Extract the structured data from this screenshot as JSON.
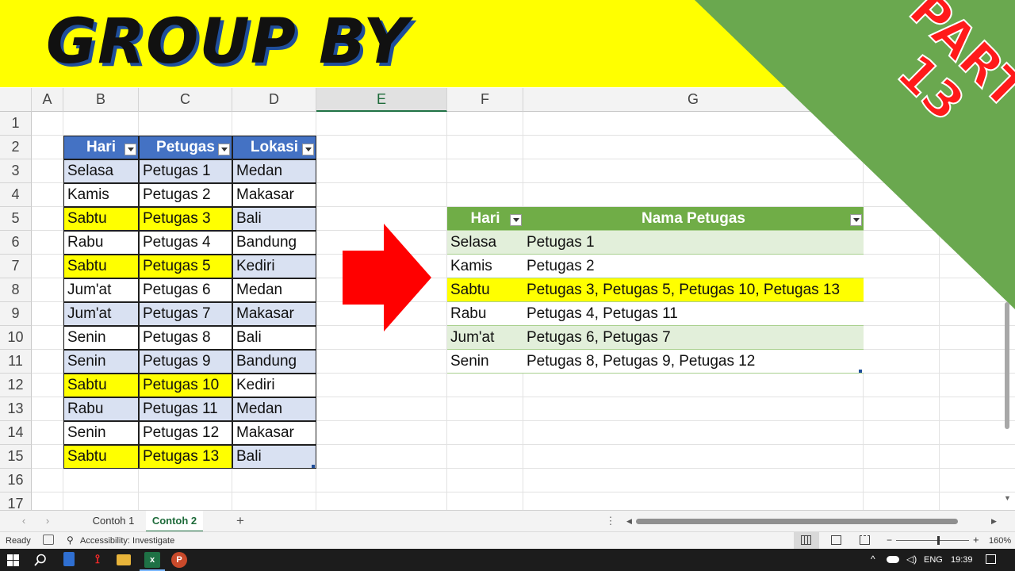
{
  "banner": {
    "title": "GROUP BY",
    "part_line1": "PART",
    "part_line2": "13"
  },
  "sheet": {
    "columns": [
      "A",
      "B",
      "C",
      "D",
      "E",
      "F",
      "G"
    ],
    "rows": [
      "1",
      "2",
      "3",
      "4",
      "5",
      "6",
      "7",
      "8",
      "9",
      "10",
      "11",
      "12",
      "13",
      "14",
      "15",
      "16",
      "17"
    ],
    "selected_column": "E"
  },
  "table1": {
    "headers": [
      "Hari",
      "Petugas",
      "Lokasi"
    ],
    "rows": [
      {
        "hari": "Selasa",
        "petugas": "Petugas 1",
        "lokasi": "Medan",
        "highlight": false
      },
      {
        "hari": "Kamis",
        "petugas": "Petugas 2",
        "lokasi": "Makasar",
        "highlight": false
      },
      {
        "hari": "Sabtu",
        "petugas": "Petugas 3",
        "lokasi": "Bali",
        "highlight": true
      },
      {
        "hari": "Rabu",
        "petugas": "Petugas 4",
        "lokasi": "Bandung",
        "highlight": false
      },
      {
        "hari": "Sabtu",
        "petugas": "Petugas 5",
        "lokasi": "Kediri",
        "highlight": true
      },
      {
        "hari": "Jum'at",
        "petugas": "Petugas 6",
        "lokasi": "Medan",
        "highlight": false
      },
      {
        "hari": "Jum'at",
        "petugas": "Petugas 7",
        "lokasi": "Makasar",
        "highlight": false
      },
      {
        "hari": "Senin",
        "petugas": "Petugas 8",
        "lokasi": "Bali",
        "highlight": false
      },
      {
        "hari": "Senin",
        "petugas": "Petugas 9",
        "lokasi": "Bandung",
        "highlight": false
      },
      {
        "hari": "Sabtu",
        "petugas": "Petugas 10",
        "lokasi": "Kediri",
        "highlight": true
      },
      {
        "hari": "Rabu",
        "petugas": "Petugas 11",
        "lokasi": "Medan",
        "highlight": false
      },
      {
        "hari": "Senin",
        "petugas": "Petugas 12",
        "lokasi": "Makasar",
        "highlight": false
      },
      {
        "hari": "Sabtu",
        "petugas": "Petugas 13",
        "lokasi": "Bali",
        "highlight": true
      }
    ]
  },
  "table2": {
    "headers": [
      "Hari",
      "Nama Petugas"
    ],
    "rows": [
      {
        "hari": "Selasa",
        "nama": "Petugas 1",
        "highlight": false
      },
      {
        "hari": "Kamis",
        "nama": "Petugas 2",
        "highlight": false
      },
      {
        "hari": "Sabtu",
        "nama": "Petugas 3, Petugas 5, Petugas 10, Petugas 13",
        "highlight": true
      },
      {
        "hari": "Rabu",
        "nama": "Petugas 4, Petugas 11",
        "highlight": false
      },
      {
        "hari": "Jum'at",
        "nama": "Petugas 6, Petugas 7",
        "highlight": false
      },
      {
        "hari": "Senin",
        "nama": "Petugas 8, Petugas 9, Petugas 12",
        "highlight": false
      }
    ]
  },
  "tabs": {
    "items": [
      "Contoh 1",
      "Contoh 2"
    ],
    "active": "Contoh 2",
    "add": "+",
    "more": "⋮"
  },
  "status": {
    "ready": "Ready",
    "accessibility": "Accessibility: Investigate",
    "zoom": "160%",
    "zoom_minus": "−",
    "zoom_plus": "+"
  },
  "taskbar": {
    "lang": "ENG",
    "time": "19:39",
    "caret": "^"
  },
  "colors": {
    "banner": "#ffff00",
    "corner_green": "#6aa84f",
    "part_text": "#ff1a1a",
    "table1_header": "#4472c4",
    "table1_band": "#d9e1f2",
    "table2_header": "#70ad47",
    "table2_band": "#e2efda",
    "highlight": "#ffff00",
    "arrow": "#ff0000"
  },
  "icons": [
    "windows-start-icon",
    "search-icon",
    "notes-app-icon",
    "acrobat-icon",
    "folder-icon",
    "excel-icon",
    "powerpoint-icon",
    "cloud-icon",
    "volume-icon",
    "notification-icon"
  ]
}
